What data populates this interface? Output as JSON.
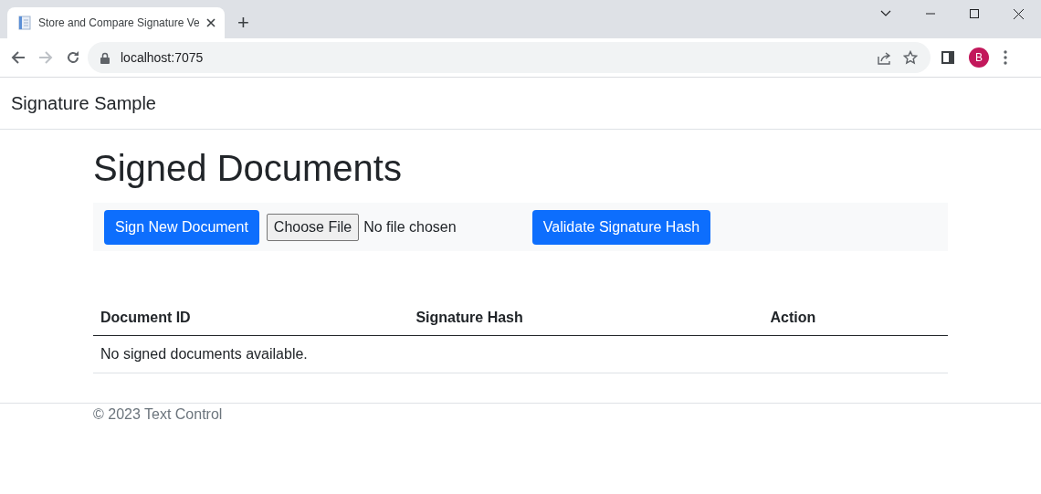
{
  "browser": {
    "tab_title": "Store and Compare Signature Ve",
    "new_tab": "+",
    "address": "localhost:7075",
    "profile_initial": "B"
  },
  "navbar": {
    "brand": "Signature Sample"
  },
  "page": {
    "heading": "Signed Documents",
    "toolbar": {
      "sign_button": "Sign New Document",
      "file_button": "Choose File",
      "file_status": "No file chosen",
      "validate_button": "Validate Signature Hash"
    },
    "table": {
      "columns": [
        "Document ID",
        "Signature Hash",
        "Action"
      ],
      "empty_message": "No signed documents available."
    }
  },
  "footer": {
    "text": "© 2023 Text Control"
  }
}
